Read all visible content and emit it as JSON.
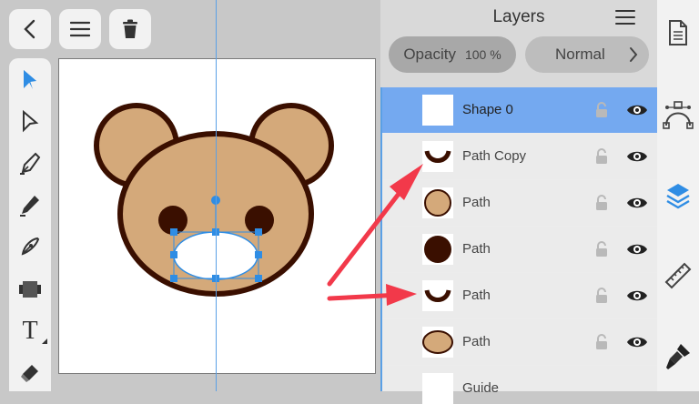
{
  "top_toolbar": {
    "back_icon": "chevron-left-icon",
    "menu_icon": "hamburger-icon",
    "delete_icon": "trash-icon"
  },
  "tools": [
    {
      "name": "select-tool",
      "icon": "arrow-solid-icon",
      "active": true
    },
    {
      "name": "direct-select-tool",
      "icon": "arrow-outline-icon"
    },
    {
      "name": "pen-tool",
      "icon": "pen-nib-icon"
    },
    {
      "name": "pencil-tool",
      "icon": "pencil-icon"
    },
    {
      "name": "brush-tool",
      "icon": "vector-brush-icon"
    },
    {
      "name": "shape-tool",
      "icon": "shape-tool-icon"
    },
    {
      "name": "text-tool",
      "icon": "text-icon",
      "label": "T"
    },
    {
      "name": "eraser-tool",
      "icon": "eraser-icon"
    }
  ],
  "layers_panel": {
    "title": "Layers",
    "opacity_label": "Opacity",
    "opacity_value": "100 %",
    "blend_mode": "Normal",
    "layers": [
      {
        "label": "Shape 0",
        "thumb": "white-square",
        "selected": true
      },
      {
        "label": "Path Copy",
        "thumb": "brown-smile"
      },
      {
        "label": "Path",
        "thumb": "tan-circle"
      },
      {
        "label": "Path",
        "thumb": "dark-circle"
      },
      {
        "label": "Path",
        "thumb": "brown-smile"
      },
      {
        "label": "Path",
        "thumb": "tan-oval"
      },
      {
        "label": "Guide",
        "thumb": "white-square"
      }
    ]
  },
  "right_sidebar": [
    "document-icon",
    "path-edit-icon",
    "layers-icon",
    "ruler-icon",
    "brush-icon"
  ],
  "colors": {
    "accent": "#74a9f0",
    "bear_fill": "#d4a97a",
    "bear_outline": "#3a0f00",
    "annotation_red": "#f2394a",
    "selection_blue": "#2f8de4"
  }
}
